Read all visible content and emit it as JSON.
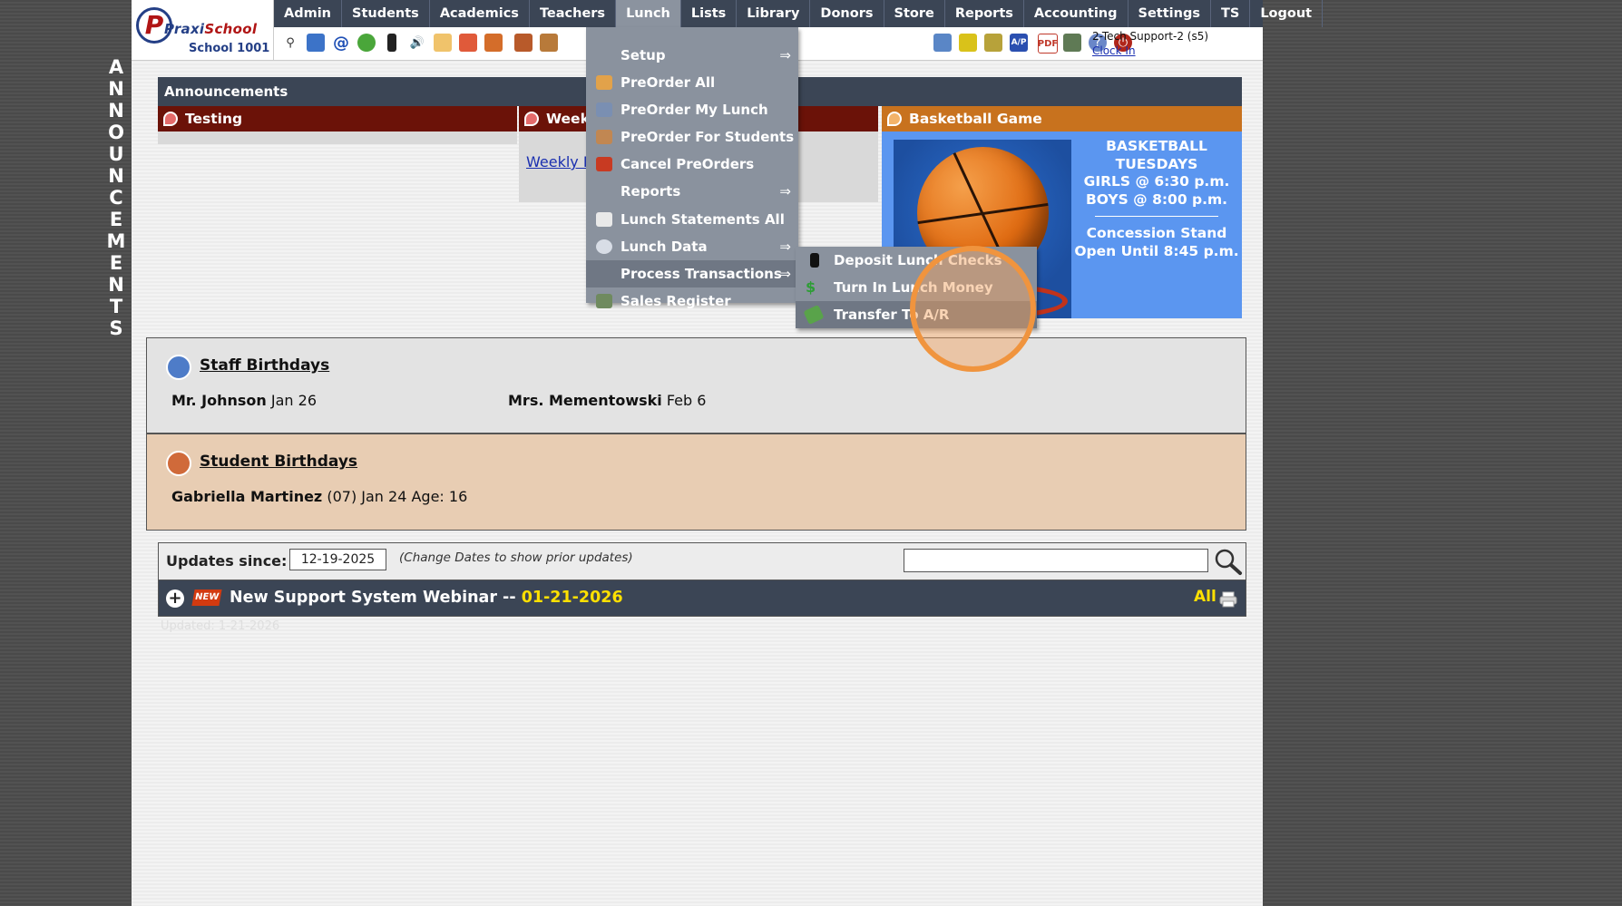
{
  "side_label": [
    "A",
    "N",
    "N",
    "O",
    "U",
    "N",
    "C",
    "E",
    "M",
    "E",
    "N",
    "T",
    "S"
  ],
  "logo": {
    "brand_a": "Praxi",
    "brand_b": "School",
    "school_name": "School 1001",
    "mark": "P"
  },
  "nav": {
    "items": [
      "Admin",
      "Students",
      "Academics",
      "Teachers",
      "Lunch",
      "Lists",
      "Library",
      "Donors",
      "Store",
      "Reports",
      "Accounting",
      "Settings",
      "TS",
      "Logout"
    ],
    "active": "Lunch"
  },
  "user": {
    "name": "2-Tech Support-2 (s5)",
    "clock_in": "Clock In"
  },
  "announcements": {
    "title": "Announcements",
    "panels": [
      {
        "title": "Testing",
        "color": "#6b1208"
      },
      {
        "title": "Weekly",
        "link": "Weekly N",
        "color": "#6b1208"
      },
      {
        "title": "Basketball Game",
        "color": "#c8721e"
      }
    ],
    "basketball_text": [
      "BASKETBALL",
      "TUESDAYS",
      "GIRLS @ 6:30 p.m.",
      "BOYS  @ 8:00 p.m."
    ],
    "basketball_text2": [
      "Concession Stand",
      "Open Until 8:45 p.m."
    ]
  },
  "staff_birthdays": {
    "title": "Staff Birthdays",
    "entries": [
      {
        "name": "Mr. Johnson",
        "date": "Jan 26"
      },
      {
        "name": "Mrs. Mementowski",
        "date": "Feb 6"
      }
    ]
  },
  "student_birthdays": {
    "title": "Student Birthdays",
    "entries": [
      {
        "name": "Gabriella Martinez",
        "detail": "(07) Jan 24 Age: 16"
      }
    ]
  },
  "updates": {
    "label": "Updates since:",
    "date": "12-19-2025",
    "hint": "(Change Dates to show prior updates)",
    "search_value": ""
  },
  "news": {
    "badge": "NEW",
    "title": "New Support System Webinar -- ",
    "date": "01-21-2026",
    "all": "All",
    "faint": "Updated: 1-21-2026"
  },
  "lunch_menu": [
    {
      "label": "Setup",
      "arrow": "⇒",
      "icon": "none"
    },
    {
      "label": "PreOrder All",
      "icon": "people-icon"
    },
    {
      "label": "PreOrder My Lunch",
      "icon": "person-icon"
    },
    {
      "label": "PreOrder For Students",
      "icon": "students-icon"
    },
    {
      "label": "Cancel PreOrders",
      "icon": "cancel-icon"
    },
    {
      "label": "Reports",
      "arrow": "⇒",
      "icon": "none"
    },
    {
      "label": "Lunch Statements All",
      "icon": "statement-icon"
    },
    {
      "label": "Lunch Data",
      "arrow": "⇒",
      "icon": "database-icon"
    },
    {
      "label": "Process Transactions",
      "arrow": "⇒",
      "icon": "none"
    },
    {
      "label": "Sales Register",
      "icon": "register-icon"
    }
  ],
  "process_submenu": [
    {
      "label": "Deposit Lunch Checks",
      "icon": "phone-icon"
    },
    {
      "label": "Turn In Lunch Money",
      "icon": "dollar-icon"
    },
    {
      "label": "Transfer To A/R",
      "icon": "money-icon"
    }
  ]
}
